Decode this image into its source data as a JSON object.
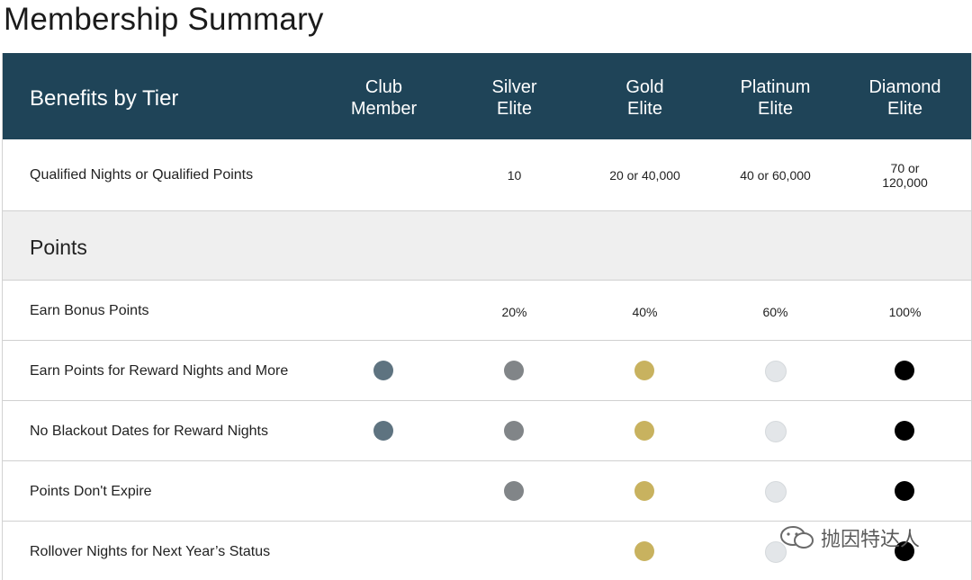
{
  "page_title": "Membership Summary",
  "header": {
    "label": "Benefits by Tier",
    "tiers": [
      {
        "line1": "Club",
        "line2": "Member"
      },
      {
        "line1": "Silver",
        "line2": "Elite"
      },
      {
        "line1": "Gold",
        "line2": "Elite"
      },
      {
        "line1": "Platinum",
        "line2": "Elite"
      },
      {
        "line1": "Diamond",
        "line2": "Elite"
      }
    ]
  },
  "qualified": {
    "label": "Qualified Nights or Qualified Points",
    "values": [
      "",
      "10",
      "20 or 40,000",
      "40 or 60,000",
      ""
    ],
    "diamond_line1": "70 or",
    "diamond_line2": "120,000"
  },
  "section_points": "Points",
  "bonus": {
    "label": "Earn Bonus Points",
    "values": [
      "",
      "20%",
      "40%",
      "60%",
      "100%"
    ]
  },
  "benefit_rows": [
    {
      "label": "Earn Points for Reward Nights and More",
      "has": [
        true,
        true,
        true,
        true,
        true
      ]
    },
    {
      "label": "No Blackout Dates for Reward Nights",
      "has": [
        true,
        true,
        true,
        true,
        true
      ]
    },
    {
      "label": "Points Don't Expire",
      "has": [
        false,
        true,
        true,
        true,
        true
      ]
    },
    {
      "label": "Rollover Nights for Next Year’s Status",
      "has": [
        false,
        false,
        true,
        true,
        true
      ]
    }
  ],
  "tier_colors": [
    "#5e7380",
    "#818588",
    "#c8b25f",
    "#e3e6e9",
    "#000000"
  ],
  "watermark": "抛因特达人"
}
